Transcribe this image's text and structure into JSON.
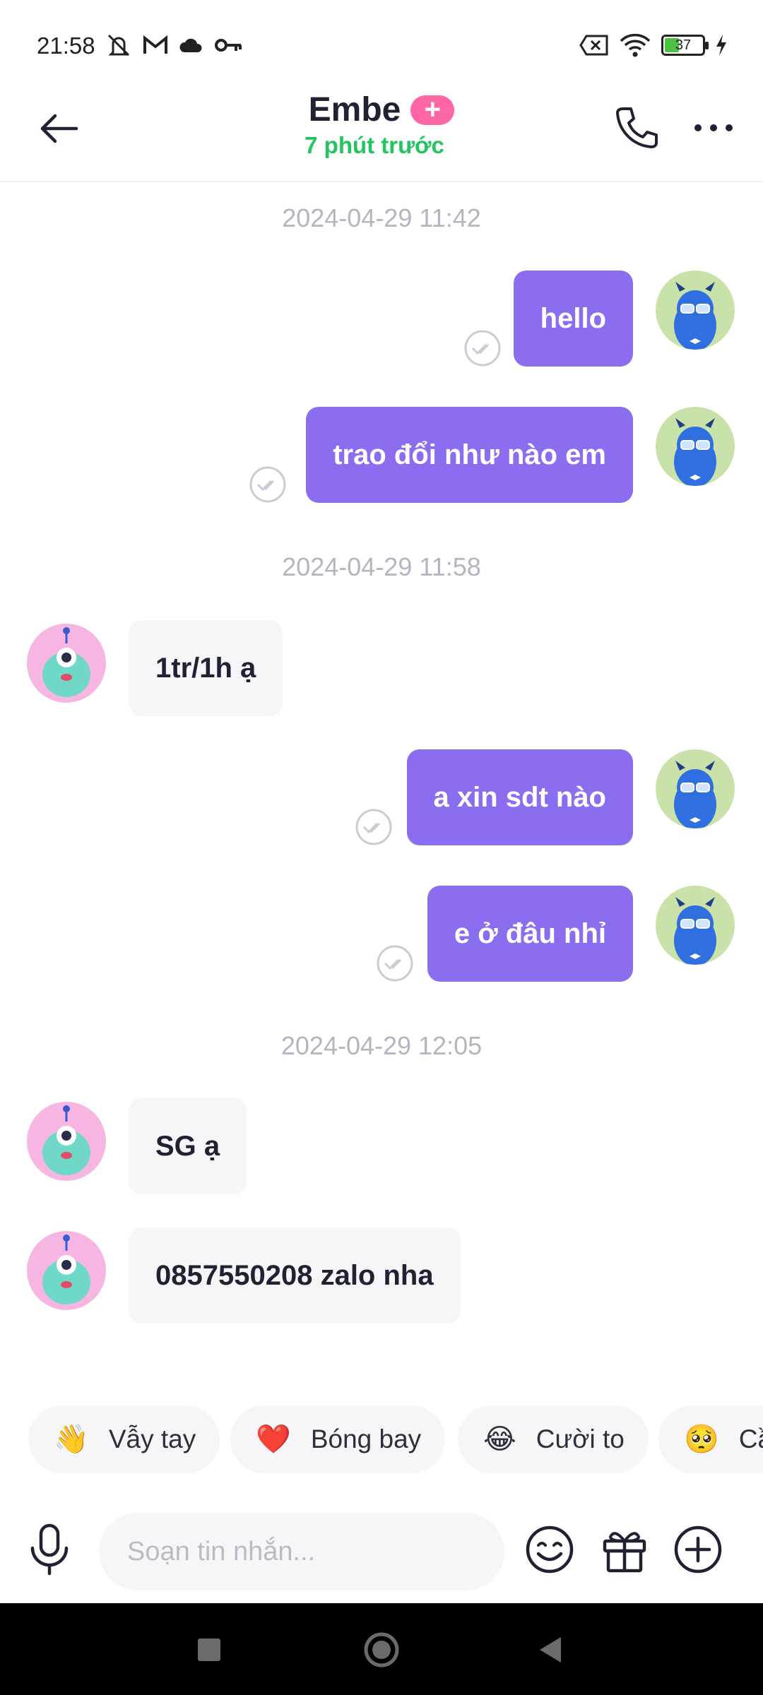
{
  "status_bar": {
    "time": "21:58",
    "battery": "37",
    "icons_left": [
      "mute-icon",
      "gmail-icon",
      "cloud-icon",
      "key-icon"
    ],
    "icons_right": [
      "no-sim-icon",
      "wifi-icon",
      "battery-icon",
      "charging-icon"
    ]
  },
  "header": {
    "title": "Embe",
    "badge": "+",
    "status": "7 phút trước",
    "status_color": "#22c55e"
  },
  "messages": [
    {
      "type": "timestamp",
      "text": "2024-04-29 11:42"
    },
    {
      "type": "out",
      "text": "hello",
      "seen": true
    },
    {
      "type": "out",
      "text": "trao đổi như nào em",
      "seen": true
    },
    {
      "type": "timestamp",
      "text": "2024-04-29 11:58"
    },
    {
      "type": "in",
      "text": "1tr/1h ạ"
    },
    {
      "type": "out",
      "text": "a xin sdt nào",
      "seen": true
    },
    {
      "type": "out",
      "text": "e ở đâu nhỉ",
      "seen": true
    },
    {
      "type": "timestamp",
      "text": "2024-04-29 12:05"
    },
    {
      "type": "in",
      "text": "SG ạ"
    },
    {
      "type": "in",
      "text": "0857550208 zalo nha"
    }
  ],
  "quick_reactions": [
    {
      "emoji": "👋",
      "label": "Vẫy tay"
    },
    {
      "emoji": "❤️",
      "label": "Bóng bay"
    },
    {
      "emoji": "😂",
      "label": "Cười to"
    },
    {
      "emoji": "🥺",
      "label": "Cầ"
    }
  ],
  "composer": {
    "placeholder": "Soạn tin nhắn..."
  },
  "colors": {
    "outgoing_bubble": "#8b6ef0",
    "incoming_bubble": "#f6f6f8",
    "badge": "#ff66a6"
  }
}
